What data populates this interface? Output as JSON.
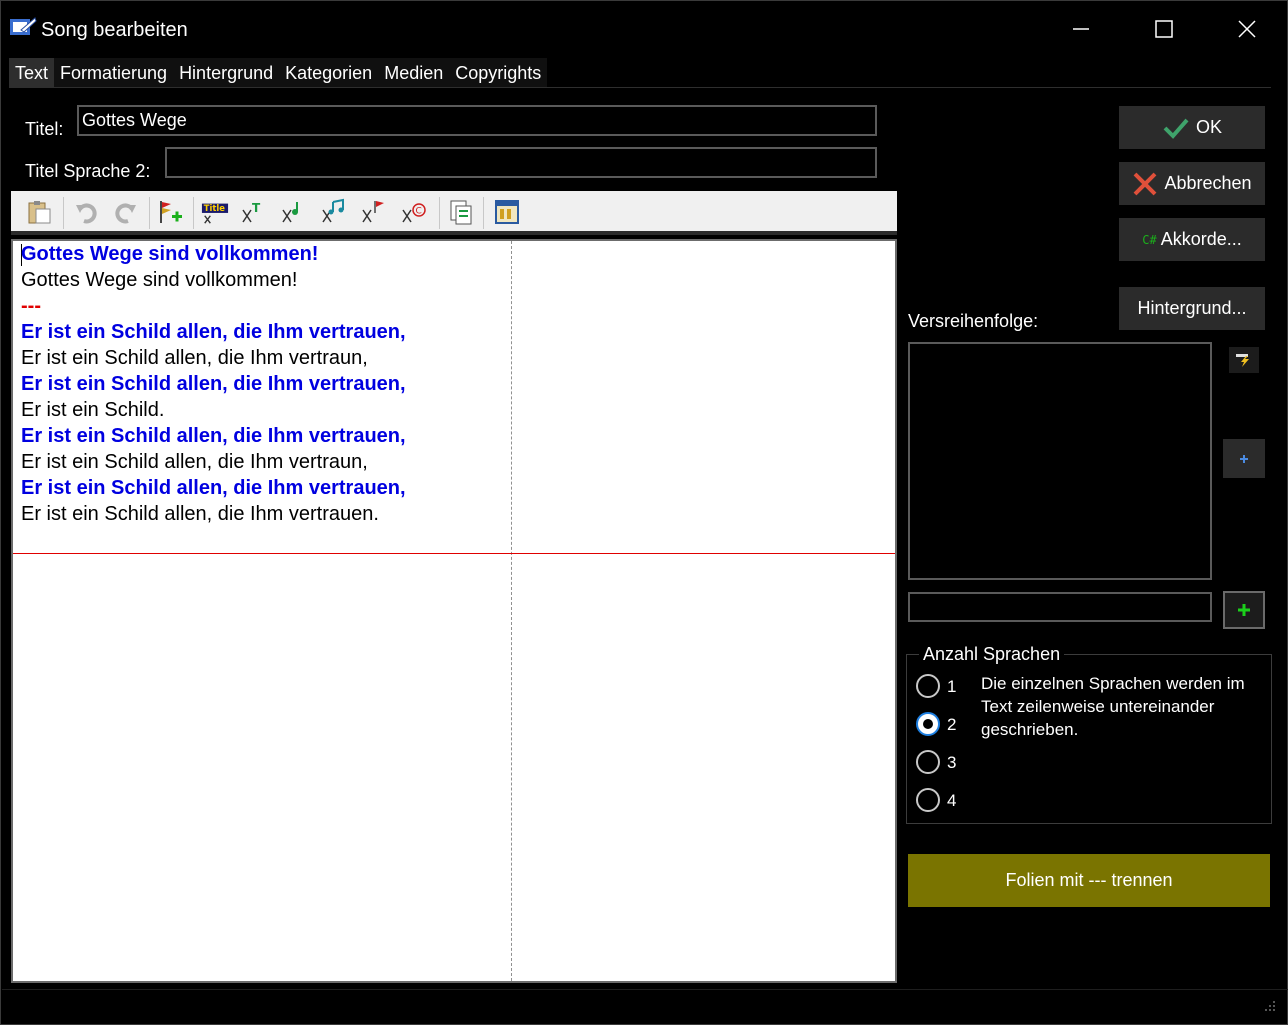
{
  "window": {
    "title": "Song bearbeiten",
    "controls": [
      "minimize",
      "maximize",
      "close"
    ]
  },
  "tabs": [
    {
      "label": "Text",
      "active": true
    },
    {
      "label": "Formatierung",
      "active": false
    },
    {
      "label": "Hintergrund",
      "active": false
    },
    {
      "label": "Kategorien",
      "active": false
    },
    {
      "label": "Medien",
      "active": false
    },
    {
      "label": "Copyrights",
      "active": false
    }
  ],
  "form": {
    "title_label": "Titel:",
    "title_value": "Gottes Wege",
    "title2_label": "Titel Sprache 2:",
    "title2_value": ""
  },
  "toolbar": {
    "icons": [
      "paste-icon",
      "undo-icon",
      "redo-icon",
      "add-section-flag-icon",
      "title-icon",
      "cut-title-icon",
      "cut-music-icon",
      "cut-music-alt-icon",
      "cut-flag-icon",
      "cut-copyright-icon",
      "document-copy-icon",
      "preview-window-icon"
    ]
  },
  "editor": {
    "lines": [
      {
        "text": "Gottes Wege sind vollkommen!",
        "type": "lang1"
      },
      {
        "text": "Gottes Wege sind vollkommen!",
        "type": "lang2"
      },
      {
        "text": "---",
        "type": "sep"
      },
      {
        "text": "Er ist ein Schild allen, die Ihm vertrauen,",
        "type": "lang1"
      },
      {
        "text": "Er ist ein Schild allen, die Ihm vertraun,",
        "type": "lang2"
      },
      {
        "text": "Er ist ein Schild allen, die Ihm vertrauen,",
        "type": "lang1"
      },
      {
        "text": "Er ist ein Schild.",
        "type": "lang2"
      },
      {
        "text": "Er ist ein Schild allen, die Ihm vertrauen,",
        "type": "lang1"
      },
      {
        "text": "Er ist ein Schild allen, die Ihm vertraun,",
        "type": "lang2"
      },
      {
        "text": "Er ist ein Schild allen, die Ihm vertrauen,",
        "type": "lang1"
      },
      {
        "text": "Er ist ein Schild allen, die Ihm vertrauen.",
        "type": "lang2"
      }
    ]
  },
  "right": {
    "ok_label": "OK",
    "cancel_label": "Abbrechen",
    "chords_label": "Akkorde...",
    "chords_prefix": "C#",
    "background_label": "Hintergrund...",
    "verse_order_label": "Versreihenfolge:",
    "verse_order_input": ""
  },
  "languages": {
    "group_title": "Anzahl Sprachen",
    "options": [
      "1",
      "2",
      "3",
      "4"
    ],
    "selected": "2",
    "description": "Die einzelnen Sprachen werden im Text zeilenweise untereinander geschrieben."
  },
  "primary_button": "Folien mit --- trennen",
  "colors": {
    "lang1_text": "#0000e0",
    "separator": "#e00000",
    "primary_button_bg": "#7a7400",
    "ok_check": "#3fa36b",
    "cancel_x": "#e0503a",
    "radio_checked": "#1e7fe0"
  }
}
